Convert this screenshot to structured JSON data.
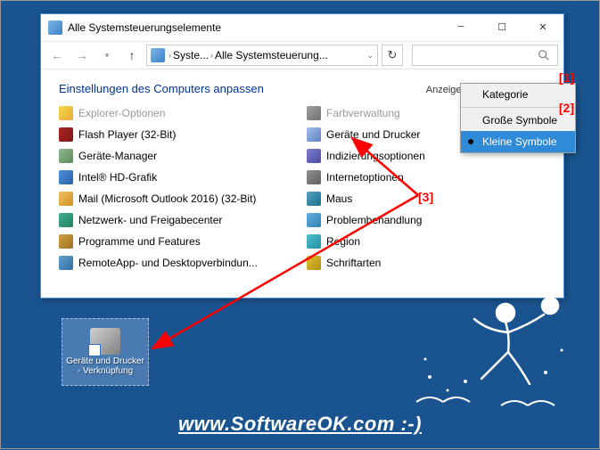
{
  "window": {
    "title": "Alle Systemsteuerungselemente"
  },
  "breadcrumb": {
    "part1": "Syste...",
    "part2": "Alle Systemsteuerung..."
  },
  "content": {
    "title": "Einstellungen des Computers anpassen",
    "viewby_label": "Anzeige:",
    "viewby_value": "Kleine Symbole"
  },
  "dropdown": {
    "items": [
      {
        "label": "Kategorie",
        "selected": false
      },
      {
        "label": "Große Symbole",
        "selected": false
      },
      {
        "label": "Kleine Symbole",
        "selected": true
      }
    ]
  },
  "items_left": [
    {
      "label": "Explorer-Optionen",
      "cut": true,
      "ico": "c0"
    },
    {
      "label": "Flash Player (32-Bit)",
      "ico": "c1"
    },
    {
      "label": "Geräte-Manager",
      "ico": "c2"
    },
    {
      "label": "Intel® HD-Grafik",
      "ico": "c3"
    },
    {
      "label": "Mail (Microsoft Outlook 2016) (32-Bit)",
      "ico": "c4"
    },
    {
      "label": "Netzwerk- und Freigabecenter",
      "ico": "c5"
    },
    {
      "label": "Programme und Features",
      "ico": "c6"
    },
    {
      "label": "RemoteApp- und Desktopverbindun...",
      "ico": "c7"
    }
  ],
  "items_right": [
    {
      "label": "Farbverwaltung",
      "cut": true,
      "ico": "c8"
    },
    {
      "label": "Geräte und Drucker",
      "ico": "c9"
    },
    {
      "label": "Indizierungsoptionen",
      "ico": "c10"
    },
    {
      "label": "Internetoptionen",
      "ico": "c11"
    },
    {
      "label": "Maus",
      "ico": "c12"
    },
    {
      "label": "Problembehandlung",
      "ico": "c13"
    },
    {
      "label": "Region",
      "ico": "c14"
    },
    {
      "label": "Schriftarten",
      "ico": "c15"
    }
  ],
  "annotations": {
    "a1": "[1]",
    "a2": "[2]",
    "a3": "[3]"
  },
  "shortcut": {
    "label": "Geräte und Drucker - Verknüpfung"
  },
  "footer": {
    "url": "www.SoftwareOK.com :-)"
  }
}
